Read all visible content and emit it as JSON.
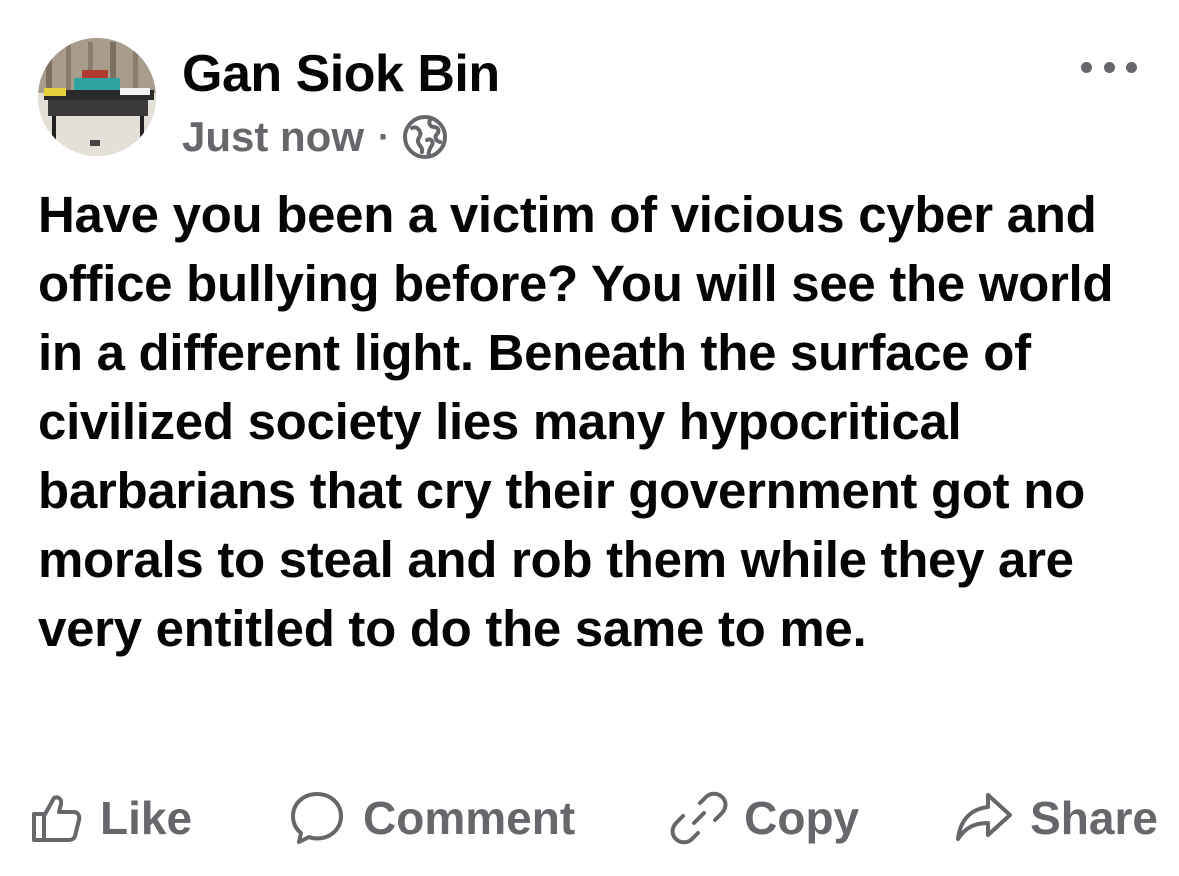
{
  "post": {
    "author": {
      "name": "Gan Siok Bin",
      "avatar_icon": "avatar-photo"
    },
    "timestamp": "Just now",
    "separator": "·",
    "audience_icon": "globe-icon",
    "more_icon": "more-options-icon",
    "text": "Have you been a victim of vicious cyber and office bullying before? You will see the world in a different light. Beneath the surface of civilized society lies many hypocritical barbarians that cry their government got no morals to steal and rob them while they are very entitled to do the same to me."
  },
  "actions": {
    "like": {
      "label": "Like",
      "icon": "thumbs-up-icon"
    },
    "comment": {
      "label": "Comment",
      "icon": "speech-bubble-icon"
    },
    "copy": {
      "label": "Copy",
      "icon": "link-icon"
    },
    "share": {
      "label": "Share",
      "icon": "share-arrow-icon"
    }
  },
  "colors": {
    "primary_text": "#050505",
    "secondary_text": "#65676b"
  }
}
